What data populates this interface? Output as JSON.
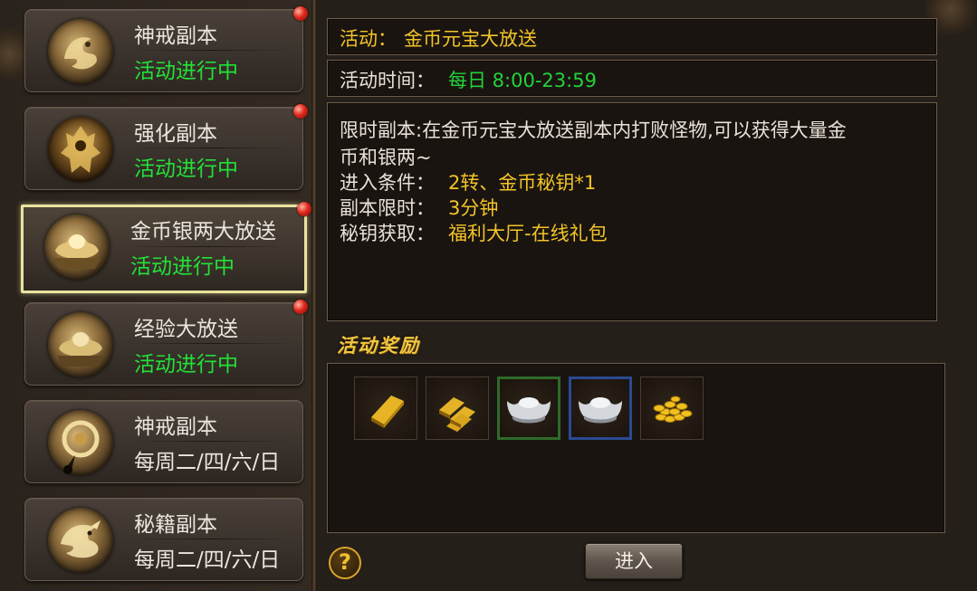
{
  "activity_list": [
    {
      "title": "神戒副本",
      "status": "活动进行中",
      "icon": "dragon-medallion-icon",
      "has_notification": true,
      "selected": false,
      "status_type": "active"
    },
    {
      "title": "强化副本",
      "status": "活动进行中",
      "icon": "armored-warrior-icon",
      "has_notification": true,
      "selected": false,
      "status_type": "active"
    },
    {
      "title": "金币银两大放送",
      "status": "活动进行中",
      "icon": "gold-ingot-icon",
      "has_notification": true,
      "selected": true,
      "status_type": "active"
    },
    {
      "title": "经验大放送",
      "status": "活动进行中",
      "icon": "gold-ingot-icon",
      "has_notification": true,
      "selected": false,
      "status_type": "active"
    },
    {
      "title": "神戒副本",
      "status": "每周二/四/六/日",
      "icon": "ring-amulet-icon",
      "has_notification": false,
      "selected": false,
      "status_type": "schedule"
    },
    {
      "title": "秘籍副本",
      "status": "每周二/四/六/日",
      "icon": "dragon-medallion-icon",
      "has_notification": false,
      "selected": false,
      "status_type": "schedule"
    }
  ],
  "detail": {
    "activity_label": "活动：",
    "activity_name": "金币元宝大放送",
    "time_label": "活动时间：",
    "time_value": "每日 8:00-23:59",
    "description_line1": "限时副本:在金币元宝大放送副本内打败怪物,可以获得大量金",
    "description_line2": "币和银两~",
    "condition_label": "进入条件：",
    "condition_value": "2转、金币秘钥*1",
    "time_limit_label": "副本限时：",
    "time_limit_value": "3分钟",
    "key_label": "秘钥获取：",
    "key_value": "福利大厅-在线礼包"
  },
  "rewards": {
    "heading": "活动奖励",
    "items": [
      {
        "icon": "gold-bar-icon",
        "border": "none"
      },
      {
        "icon": "gold-bars-stack-icon",
        "border": "none"
      },
      {
        "icon": "silver-ingot-icon",
        "border": "green"
      },
      {
        "icon": "silver-ingot-icon",
        "border": "blue"
      },
      {
        "icon": "gold-coins-pile-icon",
        "border": "none"
      }
    ]
  },
  "buttons": {
    "help": "?",
    "enter": "进入"
  },
  "colors": {
    "active_status": "#22e038",
    "highlight_yellow": "#f2c428",
    "selected_border": "#e9e3a0"
  }
}
